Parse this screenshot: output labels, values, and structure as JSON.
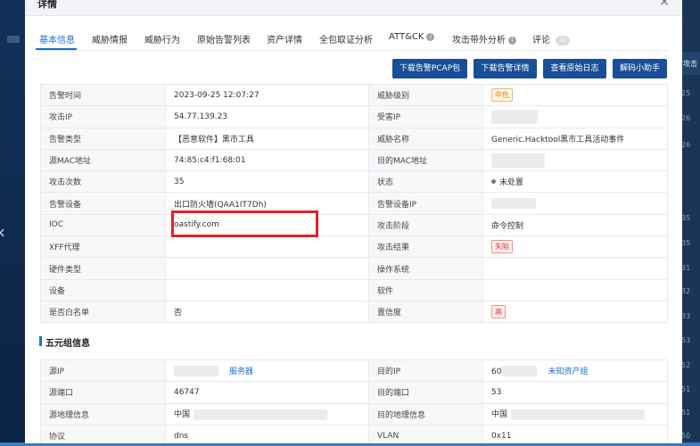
{
  "modal": {
    "title": "详情",
    "close": "×"
  },
  "tabs": [
    {
      "label": "基本信息"
    },
    {
      "label": "威胁情报"
    },
    {
      "label": "威胁行为"
    },
    {
      "label": "原始告警列表"
    },
    {
      "label": "资产详情"
    },
    {
      "label": "全包取证分析"
    },
    {
      "label": "ATT&CK"
    },
    {
      "label": "攻击带外分析"
    },
    {
      "label": "评论",
      "badge": "0"
    }
  ],
  "buttons": {
    "download_pcap": "下载告警PCAP包",
    "download_detail": "下载告警详情",
    "view_log": "查看原始日志",
    "decode_helper": "解码小助手"
  },
  "basic": {
    "alert_time_label": "告警时间",
    "alert_time": "2023-09-25 12:07:27",
    "threat_level_label": "威胁级别",
    "threat_level": "中危",
    "attack_ip_label": "攻击IP",
    "attack_ip": "54.77.139.23",
    "victim_ip_label": "受害IP",
    "alert_type_label": "告警类型",
    "alert_type": "【恶意软件】黑市工具",
    "threat_name_label": "威胁名称",
    "threat_name": "Generic.Hacktool黑市工具活动事件",
    "src_mac_label": "源MAC地址",
    "src_mac": "74:85:c4:f1:68:01",
    "dst_mac_label": "目的MAC地址",
    "attack_count_label": "攻击次数",
    "attack_count": "35",
    "status_label": "状态",
    "status": "未处置",
    "alert_device_label": "告警设备",
    "alert_device": "出口防火墙(QAA1IT7Dh)",
    "alert_device_ip_label": "告警设备IP",
    "ioc_label": "IOC",
    "ioc": "oastify.com",
    "attack_stage_label": "攻击阶段",
    "attack_stage": "命令控制",
    "xff_label": "XFF代理",
    "attack_result_label": "攻击结果",
    "attack_result": "失陷",
    "hardware_type_label": "硬件类型",
    "os_label": "操作系统",
    "device_label": "设备",
    "software_label": "软件",
    "whitelist_label": "是否白名单",
    "whitelist": "否",
    "confidence_label": "置信度",
    "confidence": "高"
  },
  "five_tuple": {
    "title": "五元组信息",
    "src_ip_label": "源IP",
    "src_ip_link": "服务器",
    "dst_ip_label": "目的IP",
    "dst_ip_prefix": "60",
    "dst_ip_link": "未知资产组",
    "src_port_label": "源端口",
    "src_port": "46747",
    "dst_port_label": "目的端口",
    "dst_port": "53",
    "src_geo_label": "源地理信息",
    "src_geo": "中国",
    "dst_geo_label": "目的地理信息",
    "dst_geo": "中国",
    "protocol_label": "协议",
    "protocol": "dns",
    "vlan_label": "VLAN",
    "vlan": "0x11"
  },
  "background": {
    "right_header": "攻击",
    "right_numbers": [
      "25",
      "26",
      "26",
      "35",
      "35",
      "31",
      "32",
      "33",
      "53",
      "52",
      "51",
      "51",
      "50"
    ]
  },
  "colors": {
    "accent": "#1b6fd8",
    "button": "#1a4f97",
    "highlight": "#e0232b"
  }
}
